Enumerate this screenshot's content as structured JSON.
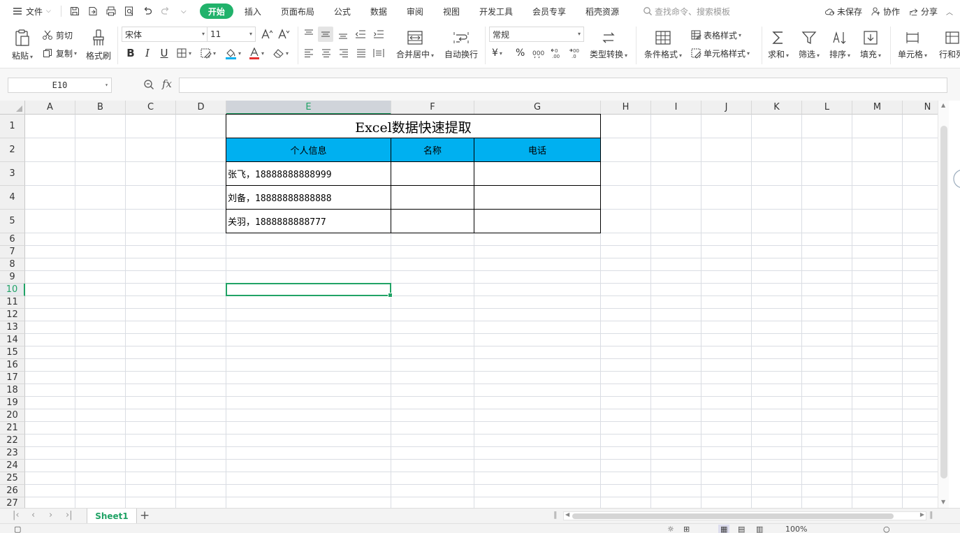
{
  "menubar": {
    "file_label": "文件",
    "tabs": [
      {
        "label": "开始",
        "active": true
      },
      {
        "label": "插入",
        "active": false
      },
      {
        "label": "页面布局",
        "active": false
      },
      {
        "label": "公式",
        "active": false
      },
      {
        "label": "数据",
        "active": false
      },
      {
        "label": "审阅",
        "active": false
      },
      {
        "label": "视图",
        "active": false
      },
      {
        "label": "开发工具",
        "active": false
      },
      {
        "label": "会员专享",
        "active": false
      },
      {
        "label": "稻壳资源",
        "active": false
      }
    ],
    "search_placeholder": "查找命令、搜索模板",
    "unsaved_label": "未保存",
    "collab_label": "协作",
    "share_label": "分享",
    "accent_color": "#21b26b"
  },
  "ribbon": {
    "paste": "粘贴",
    "cut": "剪切",
    "copy": "复制",
    "format_painter": "格式刷",
    "font_name": "宋体",
    "font_size": "11",
    "merge_center": "合并居中",
    "wrap_text": "自动换行",
    "number_format": "常规",
    "currency_symbol": "¥",
    "percent_symbol": "%",
    "type_convert": "类型转换",
    "conditional_format": "条件格式",
    "table_style": "表格样式",
    "cell_style": "单元格样式",
    "sum": "求和",
    "filter": "筛选",
    "sort": "排序",
    "fill": "填充",
    "cell": "单元格",
    "row_col": "行和列"
  },
  "formula_bar": {
    "name_box": "E10",
    "fx_label": "fx",
    "formula": ""
  },
  "sheet": {
    "columns": [
      "A",
      "B",
      "C",
      "D",
      "E",
      "F",
      "G",
      "H",
      "I",
      "J",
      "K",
      "L",
      "M",
      "N"
    ],
    "rows": [
      "1",
      "2",
      "3",
      "4",
      "5",
      "6",
      "7",
      "8",
      "9",
      "10",
      "11",
      "12",
      "13",
      "14",
      "15",
      "16",
      "17",
      "18",
      "19",
      "20",
      "21",
      "22",
      "23",
      "24",
      "25",
      "26",
      "27"
    ],
    "selected_column": "E",
    "selected_row": "10",
    "title": "Excel数据快速提取",
    "headers": [
      "个人信息",
      "名称",
      "电话"
    ],
    "data_rows": [
      [
        "张飞，18888888888999",
        "",
        ""
      ],
      [
        "刘备，18888888888888",
        "",
        ""
      ],
      [
        "关羽，1888888888777",
        "",
        ""
      ]
    ],
    "header_fill_color": "#00b0f0",
    "selection_color": "#21a366"
  },
  "sheet_tabs": {
    "tabs": [
      "Sheet1"
    ],
    "add_label": "+"
  },
  "statusbar": {
    "zoom": "100%"
  }
}
